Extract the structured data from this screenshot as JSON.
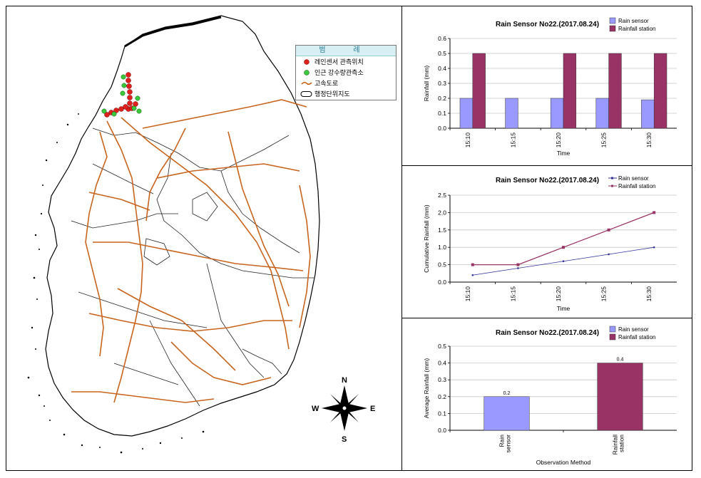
{
  "map": {
    "legend": {
      "title": "범  례",
      "items": [
        {
          "label": "레인센서 관측위치",
          "symbol": "red-dot-icon",
          "color": "#e0201c"
        },
        {
          "label": "인근 강수량관측소",
          "symbol": "green-dot-icon",
          "color": "#3cc83c"
        },
        {
          "label": "고속도로",
          "symbol": "highway-line-icon",
          "color": "#c8641e"
        },
        {
          "label": "행정단위지도",
          "symbol": "boundary-oval-icon",
          "color": "#000000"
        }
      ]
    },
    "compass": {
      "n": "N",
      "s": "S",
      "e": "E",
      "w": "W"
    }
  },
  "chart_data": [
    {
      "type": "bar",
      "title": "Rain Sensor No22.(2017.08.24)",
      "xlabel": "Time",
      "ylabel": "Rainfall (mm)",
      "categories": [
        "15:10",
        "15:15",
        "15:20",
        "15:25",
        "15:30"
      ],
      "series": [
        {
          "name": "Rain sensor",
          "color": "#9999ff",
          "values": [
            0.2,
            0.2,
            0.2,
            0.2,
            0.19
          ]
        },
        {
          "name": "Rainfall station",
          "color": "#993366",
          "values": [
            0.5,
            0,
            0.5,
            0.5,
            0.5
          ]
        }
      ],
      "ylim": [
        0,
        0.6
      ],
      "yticks": [
        "0.0",
        "0.1",
        "0.2",
        "0.3",
        "0.4",
        "0.5",
        "0.6"
      ],
      "legend": "top-right",
      "grid": true
    },
    {
      "type": "line",
      "title": "Rain Sensor No22.(2017.08.24)",
      "xlabel": "Time",
      "ylabel": "Cumulative Rainfall (mm)",
      "categories": [
        "15:10",
        "15:15",
        "15:20",
        "15:25",
        "15:30"
      ],
      "series": [
        {
          "name": "Rain sensor",
          "color": "#333399",
          "values": [
            0.2,
            0.4,
            0.6,
            0.8,
            1.0
          ]
        },
        {
          "name": "Rainfall station",
          "color": "#993366",
          "values": [
            0.5,
            0.5,
            1.0,
            1.5,
            2.0
          ]
        }
      ],
      "ylim": [
        0,
        2.5
      ],
      "yticks": [
        "0.0",
        "0.5",
        "1.0",
        "1.5",
        "2.0",
        "2.5"
      ],
      "legend": "top-right",
      "grid": true
    },
    {
      "type": "bar",
      "title": "Rain Sensor No22.(2017.08.24)",
      "xlabel": "Observation Method",
      "ylabel": "Average Rainfall (mm)",
      "categories": [
        "Rain sensor",
        "Rainfall station"
      ],
      "series": [
        {
          "name": "Rain sensor",
          "color": "#9999ff",
          "values": [
            0.2
          ]
        },
        {
          "name": "Rainfall station",
          "color": "#993366",
          "values": [
            0.4
          ]
        }
      ],
      "data_labels": [
        "0.2",
        "0.4"
      ],
      "ylim": [
        0,
        0.5
      ],
      "yticks": [
        "0.0",
        "0.1",
        "0.2",
        "0.3",
        "0.4",
        "0.5"
      ],
      "legend": "top-right",
      "grid": true
    }
  ]
}
